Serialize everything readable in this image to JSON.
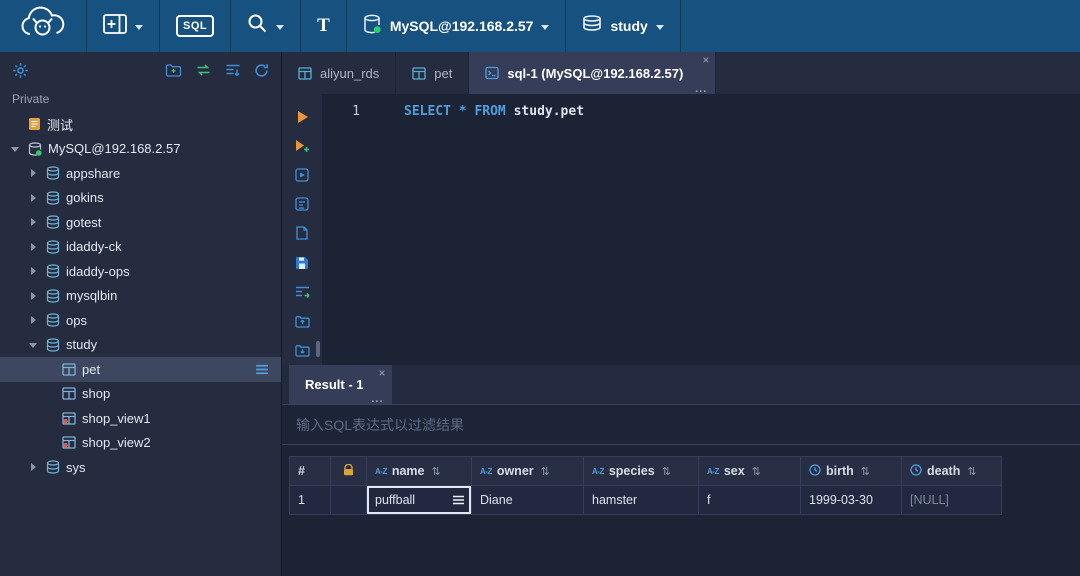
{
  "topbar": {
    "sql_badge": "SQL",
    "format_label": "T",
    "connection_label": "MySQL@192.168.2.57",
    "database_label": "study"
  },
  "sidebar": {
    "section_label": "Private",
    "tree": [
      {
        "label": "测试"
      },
      {
        "label": "MySQL@192.168.2.57"
      },
      {
        "label": "appshare"
      },
      {
        "label": "gokins"
      },
      {
        "label": "gotest"
      },
      {
        "label": "idaddy-ck"
      },
      {
        "label": "idaddy-ops"
      },
      {
        "label": "mysqlbin"
      },
      {
        "label": "ops"
      },
      {
        "label": "study"
      },
      {
        "label": "pet"
      },
      {
        "label": "shop"
      },
      {
        "label": "shop_view1"
      },
      {
        "label": "shop_view2"
      },
      {
        "label": "sys"
      }
    ]
  },
  "tabs": {
    "close_glyph": "×",
    "more_glyph": "...",
    "items": [
      {
        "label": "aliyun_rds"
      },
      {
        "label": "pet"
      },
      {
        "label": "sql-1 (MySQL@192.168.2.57)"
      }
    ]
  },
  "editor": {
    "line_number": "1",
    "sql": {
      "kw1": "SELECT",
      "star": "*",
      "kw2": "FROM",
      "table": "study.pet"
    }
  },
  "result": {
    "tab_label": "Result - 1",
    "close_glyph": "×",
    "more_glyph": "...",
    "filter_placeholder": "输入SQL表达式以过滤结果",
    "header": {
      "hash": "#",
      "az_badge": "A-Z",
      "sort_glyph": "⇅",
      "columns": [
        "name",
        "owner",
        "species",
        "sex",
        "birth",
        "death"
      ]
    },
    "row": {
      "num": "1",
      "name": "puffball",
      "owner": "Diane",
      "species": "hamster",
      "sex": "f",
      "birth": "1999-03-30",
      "death": "[NULL]"
    }
  }
}
